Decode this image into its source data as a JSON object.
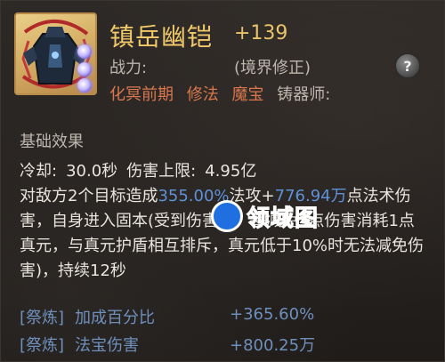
{
  "item": {
    "name": "镇岳幽铠",
    "level": "+139",
    "power_label": "战力:",
    "power_note": "(境界修正)",
    "tags": [
      "化冥前期",
      "修法",
      "魔宝",
      "铸器师:"
    ]
  },
  "base": {
    "section_title": "基础效果",
    "cooldown_label": "冷却:",
    "cooldown_value": "30.0秒",
    "cap_label": "伤害上限:",
    "cap_value": "4.95亿"
  },
  "description": {
    "p1": "对敌方2个目标造成",
    "pct": "355.00%",
    "p2": "法攻+",
    "flat": "776.94万",
    "p3": "点法术伤害，自身进入固本(受到伤害时，每减免3点伤害消耗1点真元，与真元护盾相互排斥，真元低于10%时无法减免伤害)，持续12秒"
  },
  "refine": [
    {
      "tag": "[祭炼]",
      "label": "加成百分比",
      "value": "+365.60%"
    },
    {
      "tag": "[祭炼]",
      "label": "法宝伤害",
      "value": "+800.25万"
    }
  ],
  "watermark": {
    "text": "领域图"
  },
  "icons": {
    "help": "?"
  },
  "colors": {
    "title": "#f1c96a",
    "highlight": "#5e92d8",
    "tag_red": "#d9774f",
    "refine": "#6f8fbd"
  }
}
